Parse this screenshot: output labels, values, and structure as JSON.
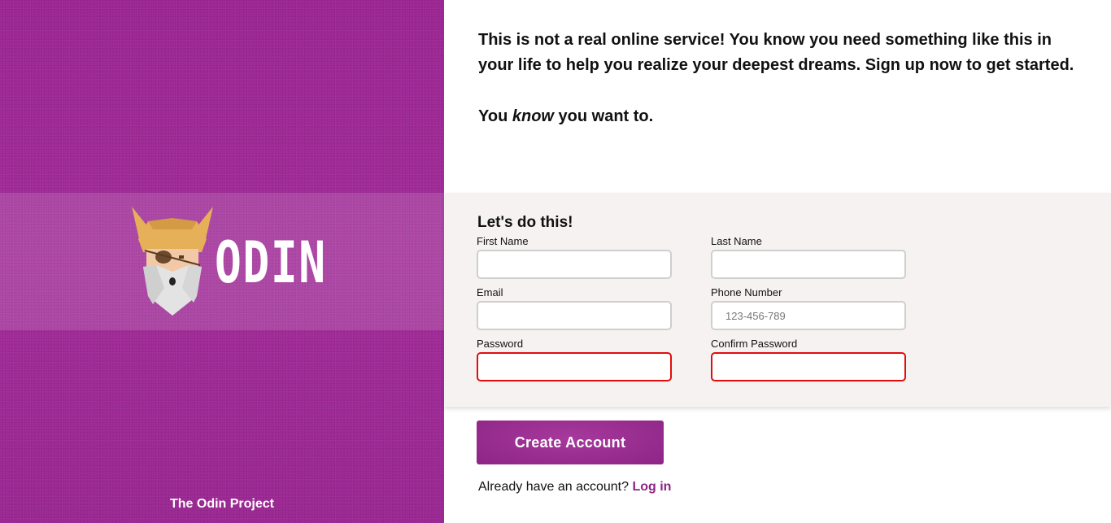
{
  "brand": {
    "logo_text": "ODIN",
    "footer_text": "The Odin Project",
    "accent_color": "#9a2592"
  },
  "intro": {
    "paragraph": "This is not a real online service! You know you need something like this in your life to help you realize your deepest dreams. Sign up now to get started.",
    "tagline_before": "You ",
    "tagline_emphasis": "know",
    "tagline_after": " you want to."
  },
  "form": {
    "heading": "Let's do this!",
    "fields": {
      "first_name": {
        "label": "First Name",
        "value": "",
        "placeholder": ""
      },
      "last_name": {
        "label": "Last Name",
        "value": "",
        "placeholder": ""
      },
      "email": {
        "label": "Email",
        "value": "",
        "placeholder": ""
      },
      "phone": {
        "label": "Phone Number",
        "value": "",
        "placeholder": "123-456-789"
      },
      "password": {
        "label": "Password",
        "value": "",
        "placeholder": ""
      },
      "confirm_password": {
        "label": "Confirm Password",
        "value": "",
        "placeholder": ""
      }
    },
    "invalid_border_color": "#e00d0d"
  },
  "actions": {
    "create_account_label": "Create Account",
    "login_prompt": "Already have an account? ",
    "login_link_label": "Log in"
  }
}
